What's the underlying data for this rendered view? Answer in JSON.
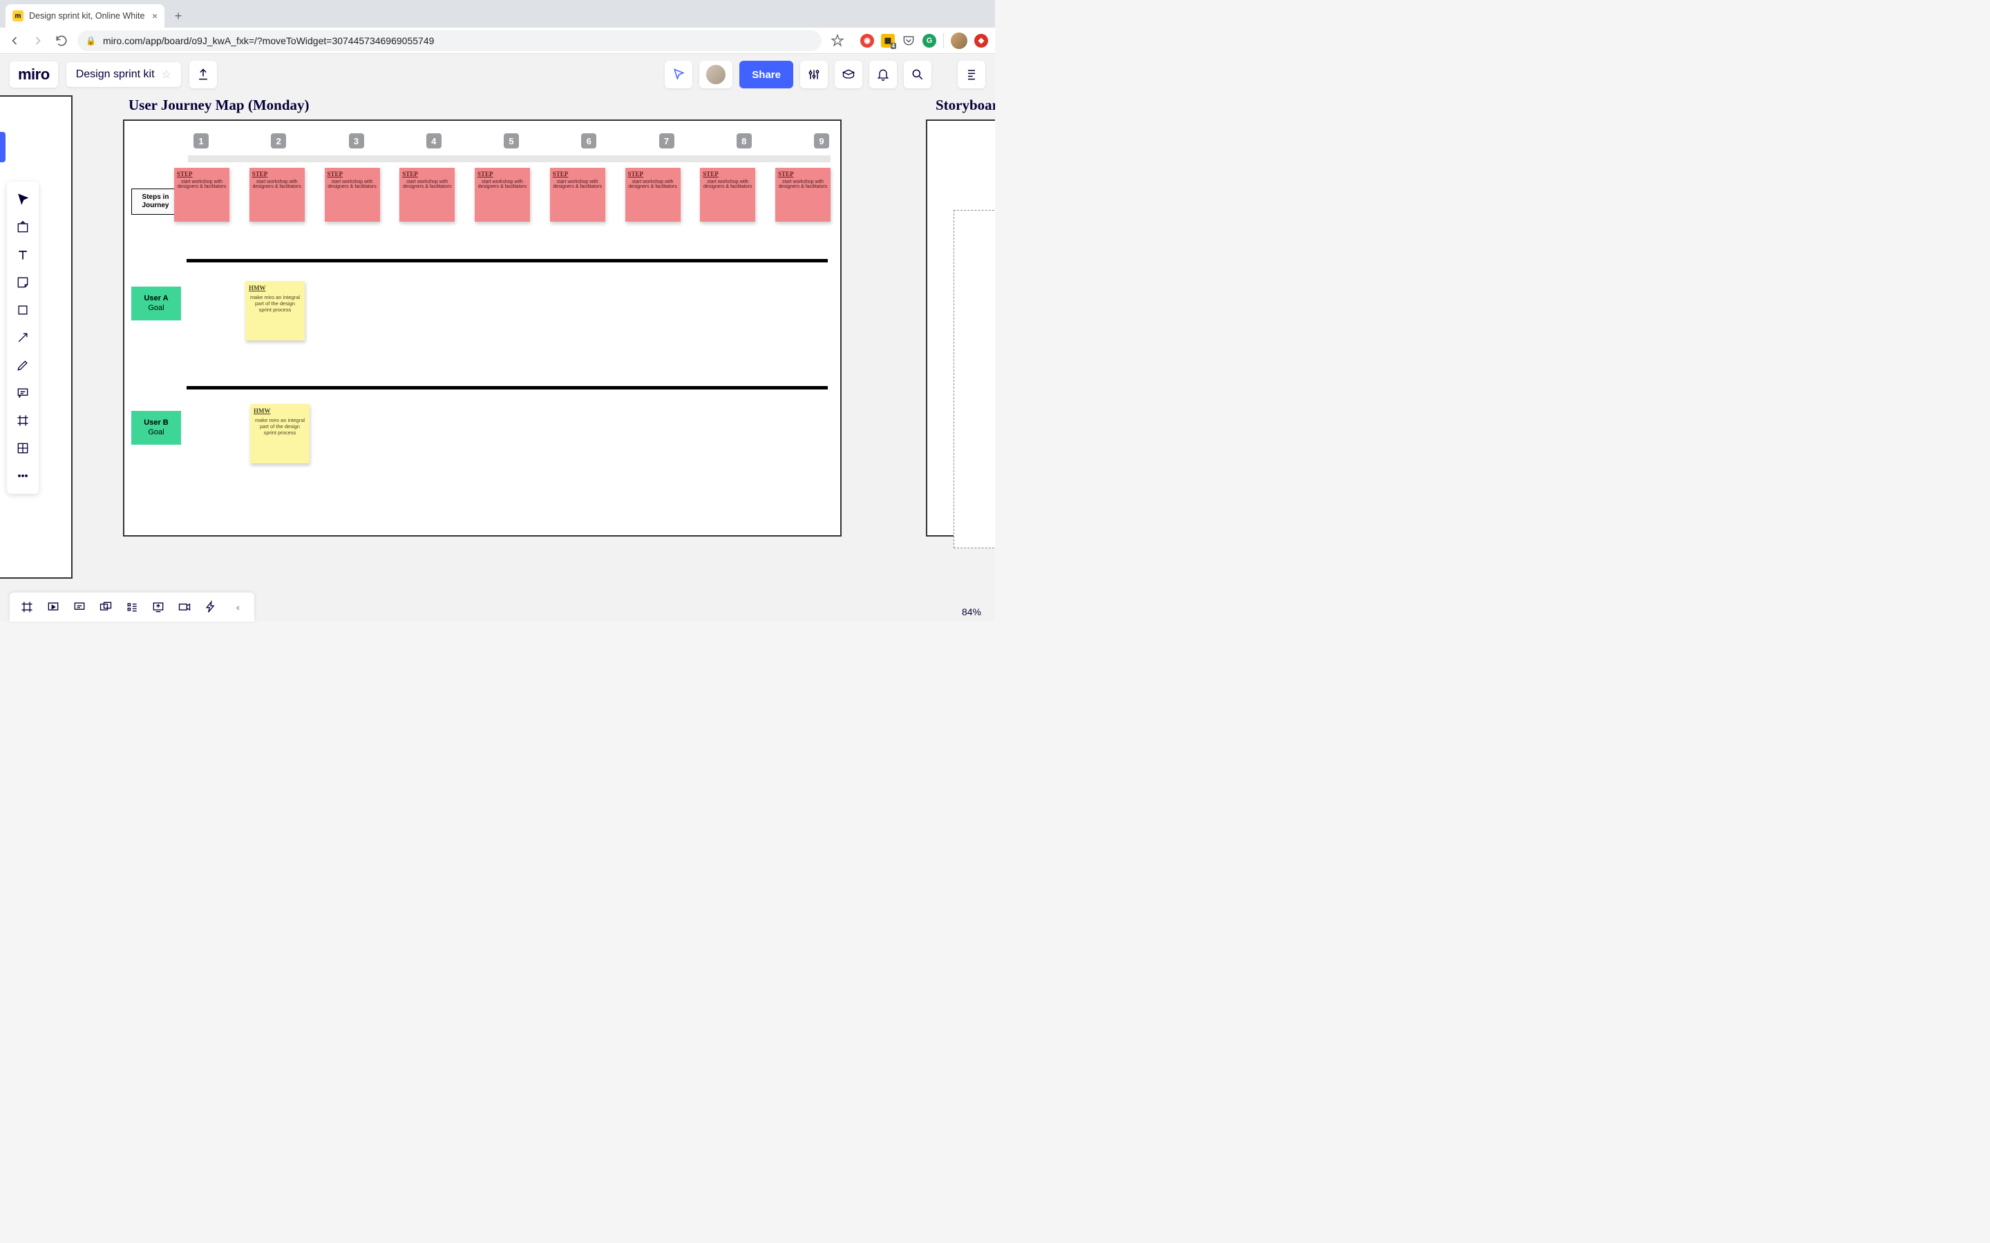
{
  "browser": {
    "tab_title": "Design sprint kit, Online White",
    "url": "miro.com/app/board/o9J_kwA_fxk=/?moveToWidget=3074457346969055749"
  },
  "header": {
    "logo": "miro",
    "board_title": "Design sprint kit",
    "share_label": "Share"
  },
  "canvas": {
    "main_frame_title": "User Journey Map (Monday)",
    "right_frame_title": "Storyboar",
    "steps_row_label": "Steps in Journey",
    "user_a_label_bold": "User A",
    "user_a_label_text": "Goal",
    "user_b_label_bold": "User B",
    "user_b_label_text": "Goal",
    "step_numbers": [
      "1",
      "2",
      "3",
      "4",
      "5",
      "6",
      "7",
      "8",
      "9"
    ],
    "pink_sticky": {
      "tag": "STEP",
      "body": "start workshop with designers & facilitators"
    },
    "yellow_sticky": {
      "tag": "HMW",
      "body": "make miro an integral part of the design sprint process"
    }
  },
  "zoom": "84%"
}
